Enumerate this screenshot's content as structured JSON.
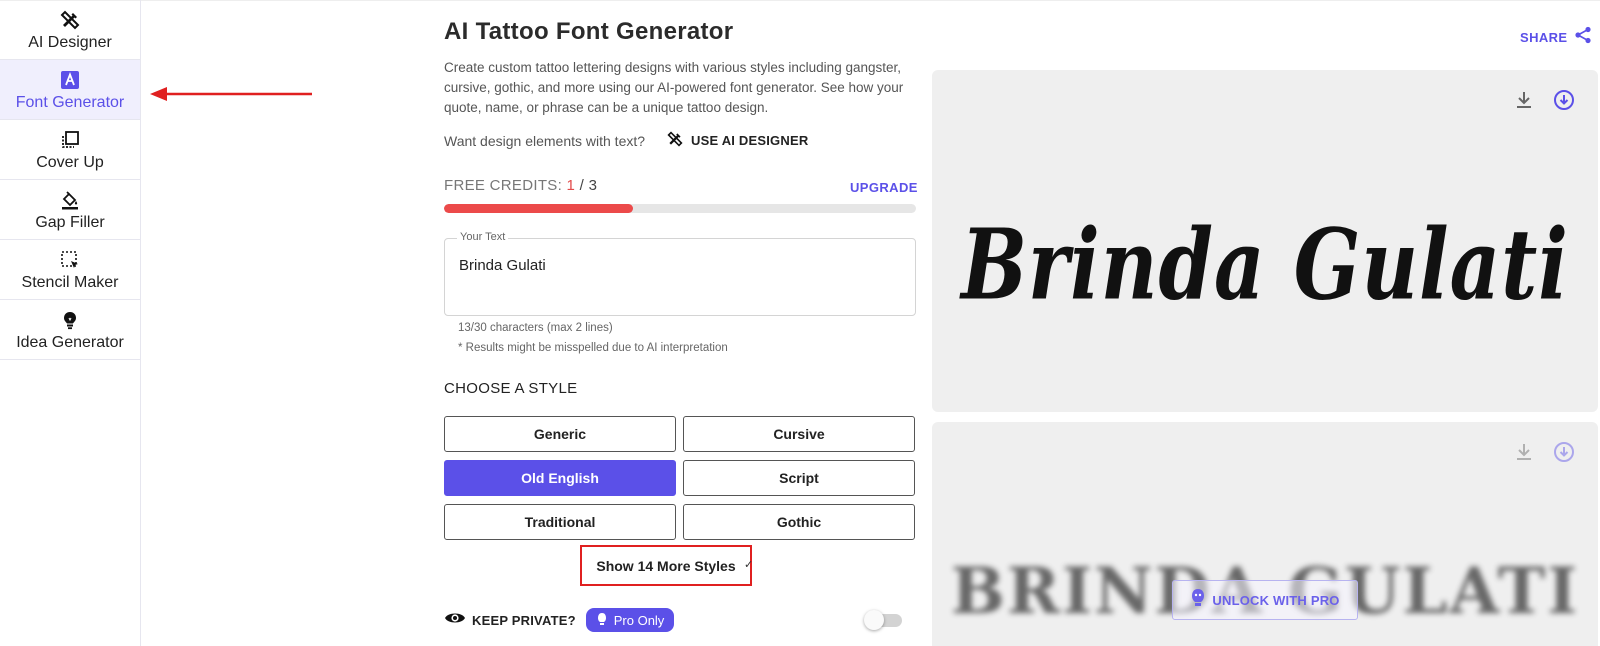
{
  "sidebar": {
    "items": [
      {
        "label": "AI Designer",
        "icon": "pen-ruler-icon",
        "active": false
      },
      {
        "label": "Font Generator",
        "icon": "letter-a-icon",
        "active": true
      },
      {
        "label": "Cover Up",
        "icon": "layers-icon",
        "active": false
      },
      {
        "label": "Gap Filler",
        "icon": "paint-bucket-icon",
        "active": false
      },
      {
        "label": "Stencil Maker",
        "icon": "selection-icon",
        "active": false
      },
      {
        "label": "Idea Generator",
        "icon": "lightbulb-icon",
        "active": false
      }
    ]
  },
  "main": {
    "title": "AI Tattoo Font Generator",
    "description": "Create custom tattoo lettering designs with various styles including gangster, cursive, gothic, and more using our AI-powered font generator. See how your quote, name, or phrase can be a unique tattoo design.",
    "want_design_text": "Want design elements with text?",
    "use_ai_designer": "USE AI DESIGNER",
    "credits": {
      "label": "FREE CREDITS: ",
      "used": "1",
      "separator": " / ",
      "total": "3",
      "progress_fraction": 0.4,
      "upgrade": "UPGRADE"
    },
    "text_input": {
      "label": "Your Text",
      "value": "Brinda Gulati",
      "char_count": "13/30 characters (max 2 lines)",
      "note": "* Results might be misspelled due to AI interpretation"
    },
    "choose_style": "CHOOSE A STYLE",
    "styles": [
      {
        "label": "Generic",
        "selected": false
      },
      {
        "label": "Cursive",
        "selected": false
      },
      {
        "label": "Old English",
        "selected": true
      },
      {
        "label": "Script",
        "selected": false
      },
      {
        "label": "Traditional",
        "selected": false
      },
      {
        "label": "Gothic",
        "selected": false
      }
    ],
    "more_styles": "Show 14 More Styles",
    "keep_private": "KEEP PRIVATE?",
    "pro_only": "Pro Only",
    "keep_private_enabled": false
  },
  "preview": {
    "share": "SHARE",
    "result_text": "Brinda Gulati",
    "blurred_text": "BRINDA GULATI",
    "unlock": "UNLOCK WITH PRO"
  },
  "colors": {
    "accent": "#5b50e8",
    "credits_bar": "#ec4a4a",
    "annotation": "#e02020"
  }
}
